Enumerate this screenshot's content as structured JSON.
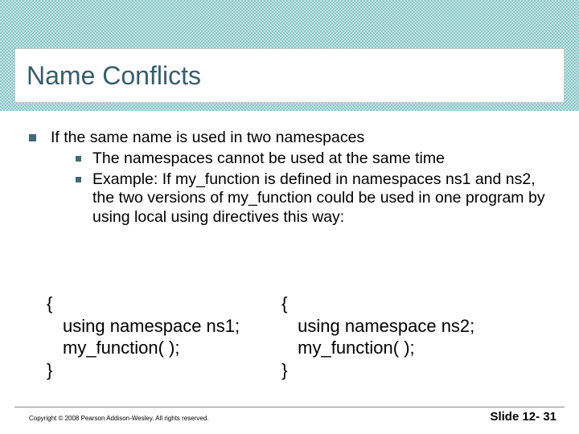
{
  "title": "Name Conflicts",
  "bullets": {
    "lead": "If the same name is used in two namespaces",
    "sub1": "The namespaces cannot be used at the same time",
    "sub2": "Example:  If  my_function is defined in namespaces ns1 and ns2,  the two versions of my_function could be used in one program by using local using directives this way:"
  },
  "code": {
    "left_open": "{",
    "left_l1": "using namespace ns1;",
    "left_l2": "my_function( );",
    "left_close": "}",
    "right_open": "{",
    "right_l1": "using namespace ns2;",
    "right_l2": "my_function( );",
    "right_close": "}"
  },
  "footer": {
    "copyright": "Copyright © 2008 Pearson Addison-Wesley.  All rights reserved.",
    "slide": "Slide 12- 31"
  }
}
